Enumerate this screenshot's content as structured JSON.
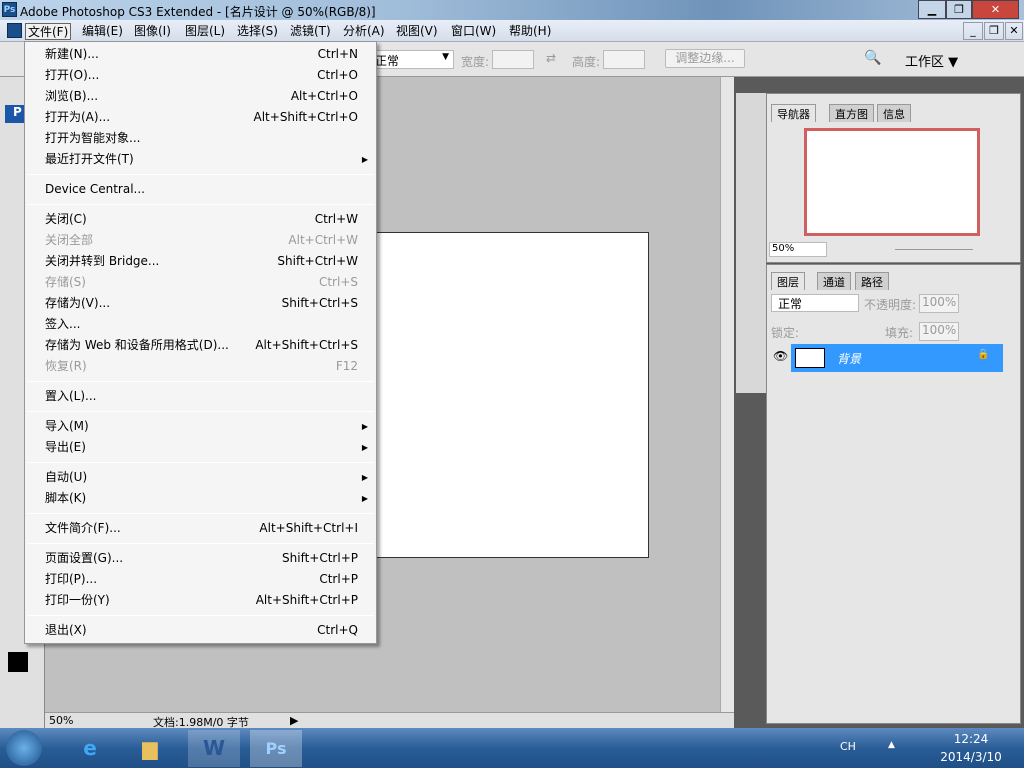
{
  "window": {
    "title": "Adobe Photoshop CS3 Extended - [名片设计 @ 50%(RGB/8)]",
    "ps_badge": "Ps"
  },
  "menubar": [
    "文件(F)",
    "编辑(E)",
    "图像(I)",
    "图层(L)",
    "选择(S)",
    "滤镜(T)",
    "分析(A)",
    "视图(V)",
    "窗口(W)",
    "帮助(H)"
  ],
  "options": {
    "style_value": "正常",
    "width_label": "宽度:",
    "height_label": "高度:",
    "refine_edge": "调整边缘...",
    "workspace": "工作区 ▼"
  },
  "file_menu": [
    {
      "label": "新建(N)...",
      "shortcut": "Ctrl+N"
    },
    {
      "label": "打开(O)...",
      "shortcut": "Ctrl+O"
    },
    {
      "label": "浏览(B)...",
      "shortcut": "Alt+Ctrl+O"
    },
    {
      "label": "打开为(A)...",
      "shortcut": "Alt+Shift+Ctrl+O"
    },
    {
      "label": "打开为智能对象...",
      "shortcut": ""
    },
    {
      "label": "最近打开文件(T)",
      "shortcut": "",
      "submenu": true
    },
    {
      "sep": true
    },
    {
      "label": "Device Central...",
      "shortcut": ""
    },
    {
      "sep": true
    },
    {
      "label": "关闭(C)",
      "shortcut": "Ctrl+W"
    },
    {
      "label": "关闭全部",
      "shortcut": "Alt+Ctrl+W",
      "disabled": true
    },
    {
      "label": "关闭并转到 Bridge...",
      "shortcut": "Shift+Ctrl+W"
    },
    {
      "label": "存储(S)",
      "shortcut": "Ctrl+S",
      "disabled": true
    },
    {
      "label": "存储为(V)...",
      "shortcut": "Shift+Ctrl+S"
    },
    {
      "label": "签入...",
      "shortcut": ""
    },
    {
      "label": "存储为 Web 和设备所用格式(D)...",
      "shortcut": "Alt+Shift+Ctrl+S"
    },
    {
      "label": "恢复(R)",
      "shortcut": "F12",
      "disabled": true
    },
    {
      "sep": true
    },
    {
      "label": "置入(L)...",
      "shortcut": ""
    },
    {
      "sep": true
    },
    {
      "label": "导入(M)",
      "shortcut": "",
      "submenu": true
    },
    {
      "label": "导出(E)",
      "shortcut": "",
      "submenu": true
    },
    {
      "sep": true
    },
    {
      "label": "自动(U)",
      "shortcut": "",
      "submenu": true
    },
    {
      "label": "脚本(K)",
      "shortcut": "",
      "submenu": true
    },
    {
      "sep": true
    },
    {
      "label": "文件简介(F)...",
      "shortcut": "Alt+Shift+Ctrl+I"
    },
    {
      "sep": true
    },
    {
      "label": "页面设置(G)...",
      "shortcut": "Shift+Ctrl+P"
    },
    {
      "label": "打印(P)...",
      "shortcut": "Ctrl+P"
    },
    {
      "label": "打印一份(Y)",
      "shortcut": "Alt+Shift+Ctrl+P"
    },
    {
      "sep": true
    },
    {
      "label": "退出(X)",
      "shortcut": "Ctrl+Q"
    }
  ],
  "navigator": {
    "tabs": [
      "导航器",
      "直方图",
      "信息"
    ],
    "zoom": "50%"
  },
  "layers": {
    "tabs": [
      "图层",
      "通道",
      "路径"
    ],
    "blend": "正常",
    "opacity_label": "不透明度:",
    "opacity": "100%",
    "lock_label": "锁定:",
    "fill_label": "填充:",
    "fill": "100%",
    "layer_name": "背景"
  },
  "status": {
    "zoom": "50%",
    "doc": "文档:1.98M/0 字节"
  },
  "taskbar": {
    "lang": "CH",
    "time": "12:24",
    "date": "2014/3/10"
  },
  "colors": {
    "selection": "#3399ff",
    "nav_frame": "#d06060"
  }
}
